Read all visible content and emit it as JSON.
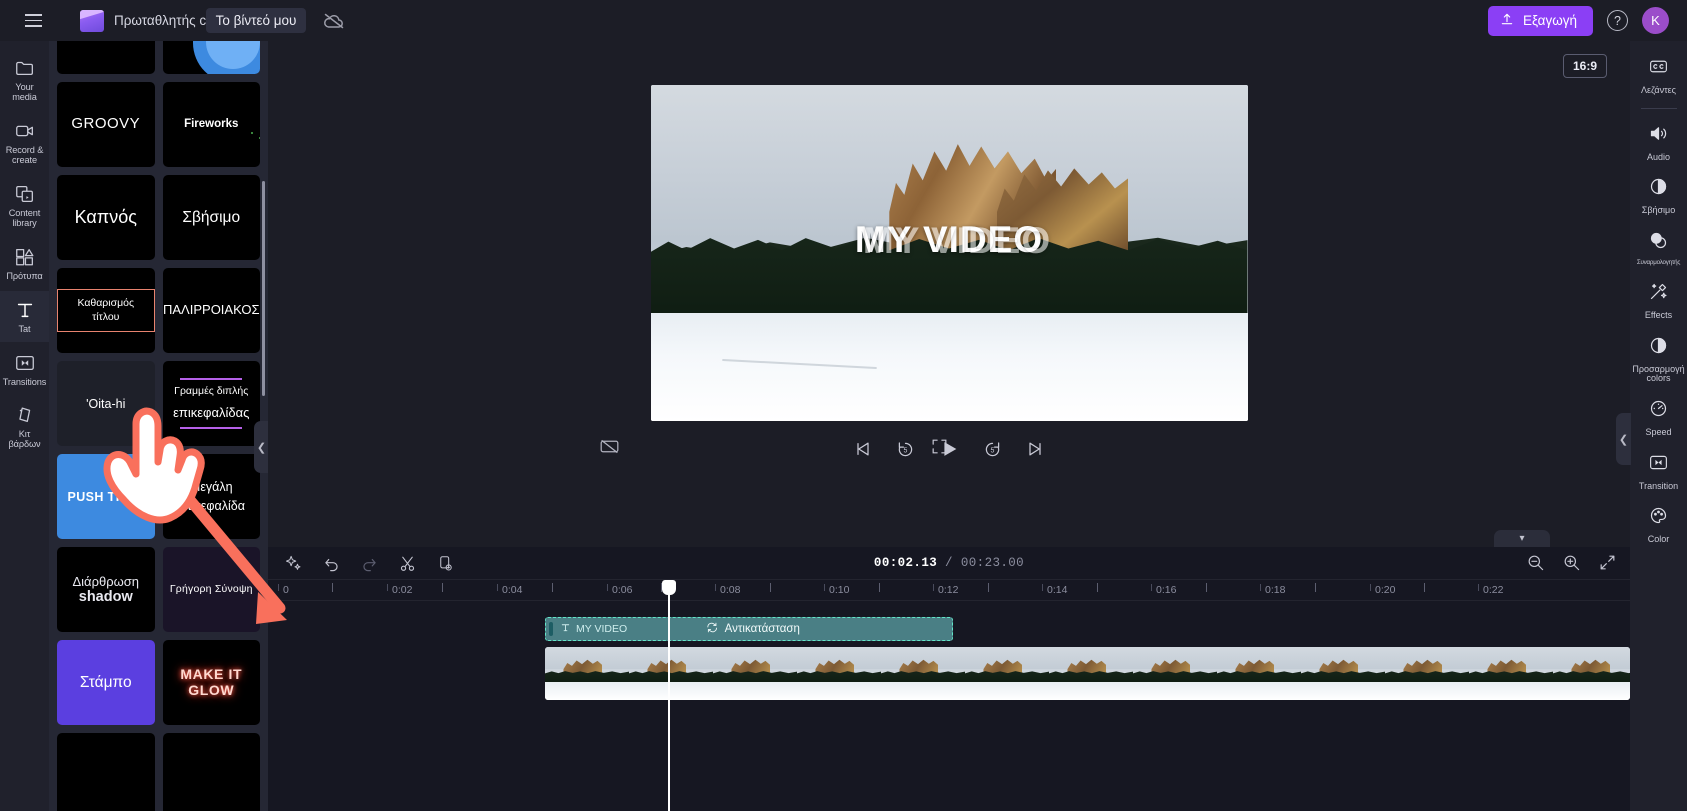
{
  "app": {
    "project_label": "Πρωταθλητής clip",
    "project_name": "Το βίντεό μου",
    "export_label": "Εξαγωγή",
    "help_label": "?",
    "avatar_initial": "K"
  },
  "left_rail": {
    "items": [
      {
        "label": "Your media",
        "icon": "folder-icon",
        "active": false
      },
      {
        "label": "Record & create",
        "icon": "camera-icon",
        "active": false
      },
      {
        "label": "Content library",
        "icon": "library-icon",
        "active": false
      },
      {
        "label": "Πρότυπα",
        "icon": "templates-icon",
        "active": false
      },
      {
        "label": "Tat",
        "icon": "text-icon",
        "active": true
      },
      {
        "label": "Transitions",
        "icon": "transitions-icon",
        "active": false
      },
      {
        "label": "Κιτ βάρδων",
        "icon": "brandkit-icon",
        "active": false
      }
    ]
  },
  "templates": {
    "items": [
      {
        "id": "blank",
        "text": "",
        "style": "blank1"
      },
      {
        "id": "blue-circle",
        "text": "",
        "style": "blue-top"
      },
      {
        "id": "groovy",
        "text": "GROOVY",
        "style": "groovy"
      },
      {
        "id": "fireworks",
        "text": "Fireworks",
        "style": "fireworks"
      },
      {
        "id": "kapnos",
        "text": "Καπνός",
        "style": "kapnos"
      },
      {
        "id": "sbisimo",
        "text": "Σβήσιμο",
        "style": "sbisimo"
      },
      {
        "id": "kathar",
        "text": "Καθαρισμός τίτλου",
        "style": "kathar"
      },
      {
        "id": "palirroiakos",
        "text": "ΠΑΛΙΡΡΟΙΑΚΟΣ",
        "style": "palir"
      },
      {
        "id": "oita-hi",
        "text": "'Oita-hi",
        "style": "oita"
      },
      {
        "id": "grammes",
        "line1": "Γραμμές διπλής",
        "line2": "επικεφαλίδας",
        "style": "gram"
      },
      {
        "id": "push-thru",
        "text": "PUSH THRU",
        "style": "push"
      },
      {
        "id": "megali",
        "text": "Μεγάλη επικεφαλίδα",
        "style": "megali"
      },
      {
        "id": "diarthrosi",
        "line1": "Διάρθρωση",
        "line2": "shadow",
        "style": "diar"
      },
      {
        "id": "grigori",
        "text": "Γρήγορη Σύνοψη",
        "style": "grig"
      },
      {
        "id": "stampo",
        "text": "Στάμπο",
        "style": "stampo"
      },
      {
        "id": "make-it-glow",
        "line1": "MAKE IT",
        "line2": "GLOW",
        "style": "glow"
      }
    ]
  },
  "preview": {
    "ratio": "16:9",
    "video_title": "MY VIDEO",
    "cc_icon": "captions-off-icon",
    "fullscreen_icon": "fullscreen-icon",
    "controls": [
      {
        "name": "skip-to-start-button",
        "icon": "skip-start-icon"
      },
      {
        "name": "rewind-5-button",
        "icon": "rewind-5-icon",
        "label": "5"
      },
      {
        "name": "play-button",
        "icon": "play-icon"
      },
      {
        "name": "forward-5-button",
        "icon": "forward-5-icon",
        "label": "5"
      },
      {
        "name": "skip-to-end-button",
        "icon": "skip-end-icon"
      }
    ]
  },
  "timeline": {
    "current_time": "00:02.13",
    "separator": " / ",
    "total_time": "00:23.00",
    "tools": [
      {
        "name": "magic-tool",
        "icon": "sparkle-icon"
      },
      {
        "name": "undo-button",
        "icon": "undo-icon"
      },
      {
        "name": "redo-button",
        "icon": "redo-icon"
      },
      {
        "name": "split-button",
        "icon": "scissors-icon"
      },
      {
        "name": "duplicate-button",
        "icon": "duplicate-icon"
      }
    ],
    "zoom_tools": [
      {
        "name": "zoom-out-button",
        "icon": "zoom-out-icon"
      },
      {
        "name": "zoom-in-button",
        "icon": "zoom-in-icon"
      },
      {
        "name": "fit-timeline-button",
        "icon": "fit-icon"
      }
    ],
    "ruler_labels": [
      "0",
      "0:02",
      "0:04",
      "0:06",
      "0:08",
      "0:10",
      "0:12",
      "0:14",
      "0:16",
      "0:18",
      "0:20",
      "0:22"
    ],
    "text_clip": {
      "label": "MY VIDEO",
      "replace_label": "Αντικατάσταση",
      "icon": "text-clip-icon",
      "replace_icon": "replace-icon"
    },
    "video_clip": {
      "thumbnail_count": 15
    }
  },
  "right_rail": {
    "items": [
      {
        "label": "Λεζάντες",
        "icon": "captions-icon",
        "sep_after": true
      },
      {
        "label": "Audio",
        "icon": "volume-icon"
      },
      {
        "label": "Σβήσιμο",
        "icon": "fade-icon"
      },
      {
        "label": "Συναρμολογητής",
        "icon": "blend-icon",
        "small": true
      },
      {
        "label": "Effects",
        "icon": "effects-icon"
      },
      {
        "label": "Προσαρμογή colors",
        "icon": "adjust-colors-icon"
      },
      {
        "label": "Speed",
        "icon": "speed-icon"
      },
      {
        "label": "Transition",
        "icon": "transition-icon"
      },
      {
        "label": "Color",
        "icon": "color-icon"
      }
    ]
  },
  "colors": {
    "accent": "#8b3ff5",
    "clip_border": "#62e6c8",
    "clip_fill": "#4a7f85",
    "pointer": "#f9705c"
  }
}
